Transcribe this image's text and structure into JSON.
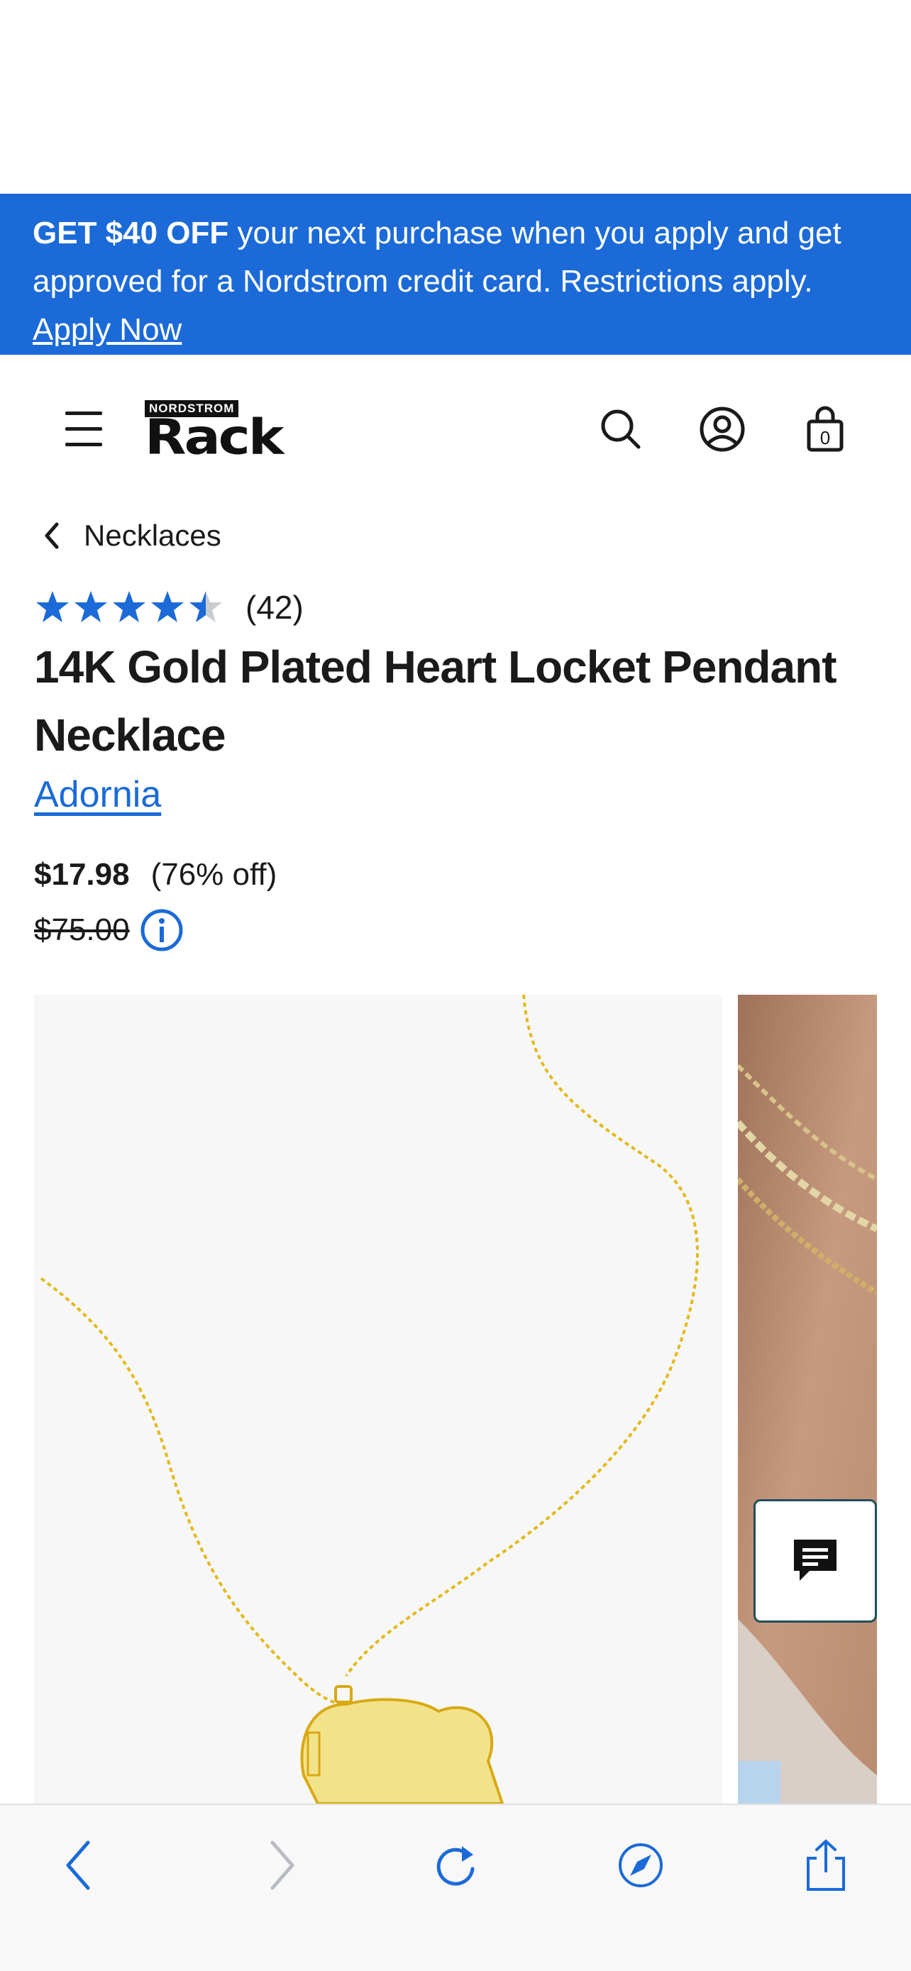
{
  "promo": {
    "bold": "GET $40 OFF",
    "text": " your next purchase when you apply and get approved for a Nordstrom credit card. Restrictions apply. ",
    "link": "Apply Now"
  },
  "header": {
    "logo_top": "NORDSTROM",
    "logo_main": "Rack",
    "bag_count": "0"
  },
  "breadcrumb": {
    "label": "Necklaces"
  },
  "rating": {
    "stars": 4.5,
    "count": "(42)"
  },
  "product": {
    "title": "14K Gold Plated Heart Locket Pendant Necklace",
    "brand": "Adornia",
    "price": "$17.98",
    "discount": "(76% off)",
    "original_price": "$75.00"
  },
  "colors": {
    "accent": "#1b6ad8",
    "star_empty": "#c7ccd1",
    "gold": "#e3b91a"
  },
  "icons": {
    "menu": "hamburger-icon",
    "search": "search-icon",
    "account": "account-icon",
    "bag": "bag-icon",
    "back": "chevron-left-icon",
    "info": "info-icon",
    "chat": "chat-icon"
  }
}
